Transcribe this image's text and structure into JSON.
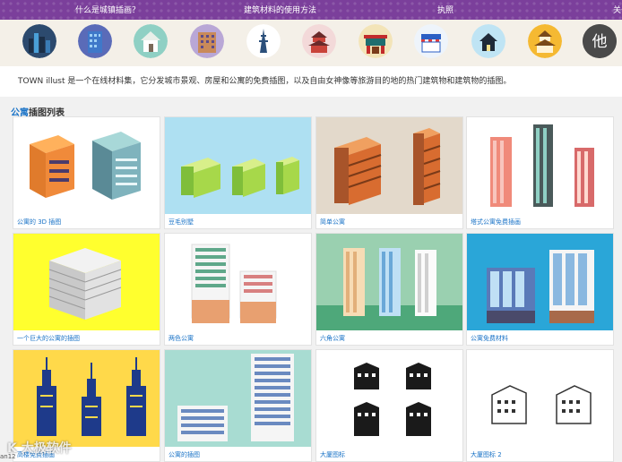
{
  "nav": {
    "items": [
      "什么是城镇插画？",
      "建筑材料的使用方法",
      "执照",
      "关于"
    ]
  },
  "categories": [
    {
      "icon": "city-skyline-icon"
    },
    {
      "icon": "office-building-icon"
    },
    {
      "icon": "house-icon"
    },
    {
      "icon": "apartment-icon"
    },
    {
      "icon": "tower-icon"
    },
    {
      "icon": "temple-icon"
    },
    {
      "icon": "shrine-gate-icon"
    },
    {
      "icon": "shop-icon"
    },
    {
      "icon": "dark-house-icon"
    },
    {
      "icon": "castle-icon"
    },
    {
      "icon": "other-icon",
      "label": "他"
    }
  ],
  "intro": {
    "text": "TOWN illust 是一个在线材料集，它分发城市景观、房屋和公寓的免费插图，以及自由女神像等旅游目的地的热门建筑物和建筑物的插图。"
  },
  "section": {
    "highlight": "公寓",
    "title": "插图列表"
  },
  "cards": [
    {
      "caption": "公寓的 3D 插图"
    },
    {
      "caption": "豆毛别墅"
    },
    {
      "caption": "简单公寓"
    },
    {
      "caption": "塔式公寓免费插画"
    },
    {
      "caption": "一个巨大的公寓的插图"
    },
    {
      "caption": "两色公寓"
    },
    {
      "caption": "六角公寓"
    },
    {
      "caption": "公寓免费材料"
    },
    {
      "caption": "高楼免费插画"
    },
    {
      "caption": "公寓的插图"
    },
    {
      "caption": "大厦图标"
    },
    {
      "caption": "大厦图标 2"
    }
  ],
  "watermark": {
    "text": "K 大极软件",
    "sub": "an12"
  },
  "colors": {
    "nav_bg": "#7b3f9b",
    "link": "#1a73c7"
  }
}
